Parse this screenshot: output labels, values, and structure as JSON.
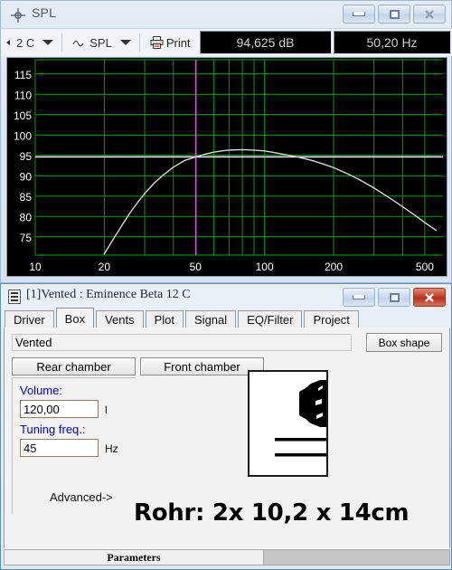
{
  "spl_window": {
    "title": "SPL",
    "title_icon": "crosshair-icon",
    "buttons": {
      "minimize": "minimize-icon",
      "maximize": "maximize-icon",
      "close": "close-icon"
    },
    "toolbar": {
      "channel_combo": "2 C",
      "curve_combo": "SPL",
      "print_label": "Print",
      "readout_db": "94,625 dB",
      "readout_hz": "50,20 Hz"
    }
  },
  "chart_data": {
    "type": "line",
    "title": "SPL",
    "xlabel": "",
    "ylabel": "",
    "xscale": "log",
    "xlim": [
      10,
      600
    ],
    "ylim": [
      70.5,
      118.5
    ],
    "xticks": [
      10,
      20,
      50,
      100,
      200,
      500
    ],
    "xtick_labels": [
      "10",
      "20",
      "50",
      "100",
      "200",
      "500"
    ],
    "yticks": [
      75,
      80,
      85,
      90,
      95,
      100,
      105,
      110,
      115
    ],
    "ytick_labels": [
      "75",
      "80",
      "85",
      "90",
      "95",
      "100",
      "105",
      "110",
      "115"
    ],
    "grid": true,
    "grid_color": "#00a000",
    "background": "#000000",
    "series": [
      {
        "name": "SPL",
        "color": "#d8d8d8",
        "x": [
          20,
          22,
          24,
          26,
          28,
          30,
          33,
          36,
          40,
          45,
          50,
          55,
          60,
          65,
          70,
          80,
          90,
          100,
          110,
          120,
          140,
          160,
          180,
          200,
          230,
          260,
          300,
          350,
          400,
          450,
          500,
          560
        ],
        "y": [
          70.8,
          74.6,
          78.0,
          81.0,
          83.5,
          85.6,
          88.2,
          90.1,
          92.1,
          93.8,
          94.6,
          95.3,
          95.8,
          96.1,
          96.3,
          96.4,
          96.3,
          96.1,
          95.7,
          95.3,
          94.6,
          93.8,
          92.9,
          92.0,
          90.5,
          89.0,
          87.0,
          84.6,
          82.4,
          80.4,
          78.5,
          76.6
        ]
      }
    ],
    "cursor": {
      "vertical_freq": 50.2,
      "vertical_color": "#d060d0",
      "horizontal_db": 94.625,
      "horizontal_color": "#ffffff"
    }
  },
  "box_window": {
    "title": "[1]Vented : Eminence Beta 12 C",
    "title_icon": "document-icon",
    "buttons": {
      "minimize": "minimize-icon",
      "maximize": "maximize-icon",
      "close": "close-icon"
    },
    "tabs": [
      {
        "label": "Driver",
        "active": false
      },
      {
        "label": "Box",
        "active": true
      },
      {
        "label": "Vents",
        "active": false
      },
      {
        "label": "Plot",
        "active": false
      },
      {
        "label": "Signal",
        "active": false
      },
      {
        "label": "EQ/Filter",
        "active": false
      },
      {
        "label": "Project",
        "active": false
      }
    ],
    "box_tab": {
      "name_value": "Vented",
      "box_shape_label": "Box shape",
      "rear_chamber_label": "Rear chamber",
      "front_chamber_label": "Front chamber",
      "volume_label": "Volume:",
      "volume_value": "120,00",
      "volume_unit": "l",
      "tuning_label": "Tuning freq.:",
      "tuning_value": "45",
      "tuning_unit": "Hz",
      "advanced_label": "Advanced->",
      "annotation": "Rohr: 2x 10,2 x 14cm"
    },
    "statusbar": {
      "pane1": "Parameters"
    }
  }
}
